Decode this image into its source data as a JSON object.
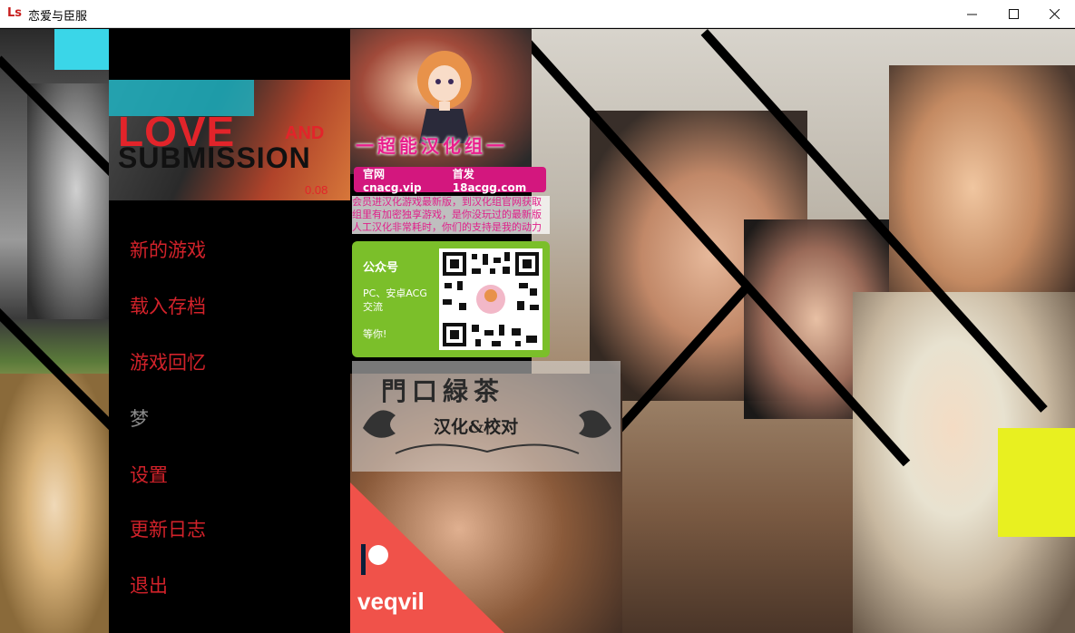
{
  "window": {
    "icon_text": "Ls",
    "title": "恋爱与臣服",
    "controls": {
      "minimize": "minimize",
      "maximize": "maximize",
      "close": "close"
    }
  },
  "logo": {
    "love": "LOVE",
    "and": "AND",
    "submission": "SUBMISSION",
    "version": "0.08"
  },
  "menu": {
    "items": [
      {
        "label": "新的游戏",
        "enabled": true
      },
      {
        "label": "载入存档",
        "enabled": true
      },
      {
        "label": "游戏回忆",
        "enabled": true
      },
      {
        "label": "梦",
        "enabled": false
      },
      {
        "label": "设置",
        "enabled": true
      },
      {
        "label": "更新日志",
        "enabled": true
      },
      {
        "label": "退出",
        "enabled": true
      }
    ]
  },
  "translator": {
    "group_name": "一超能汉化组一",
    "site_label": "官网 cnacg.vip",
    "site_label2": "首发18acgg.com",
    "notice_lines": [
      "会员进汉化游戏最新版，到汉化组官网获取",
      "组里有加密独享游戏，是你没玩过的最新版",
      "人工汉化非常耗时，你们的支持是我的动力"
    ],
    "qr": {
      "title": "公众号",
      "desc": "PC、安卓ACG交流",
      "wait": "等你!"
    }
  },
  "credit": {
    "names": "門口緑茶",
    "sub": "汉化&校对"
  },
  "patreon": {
    "name": "veqvil"
  },
  "colors": {
    "menu_text": "#d2222a",
    "menu_disabled": "#8a8a8a",
    "brand_pink": "#d3177e",
    "qr_green": "#7bbf2a",
    "patreon": "#f0524a"
  }
}
